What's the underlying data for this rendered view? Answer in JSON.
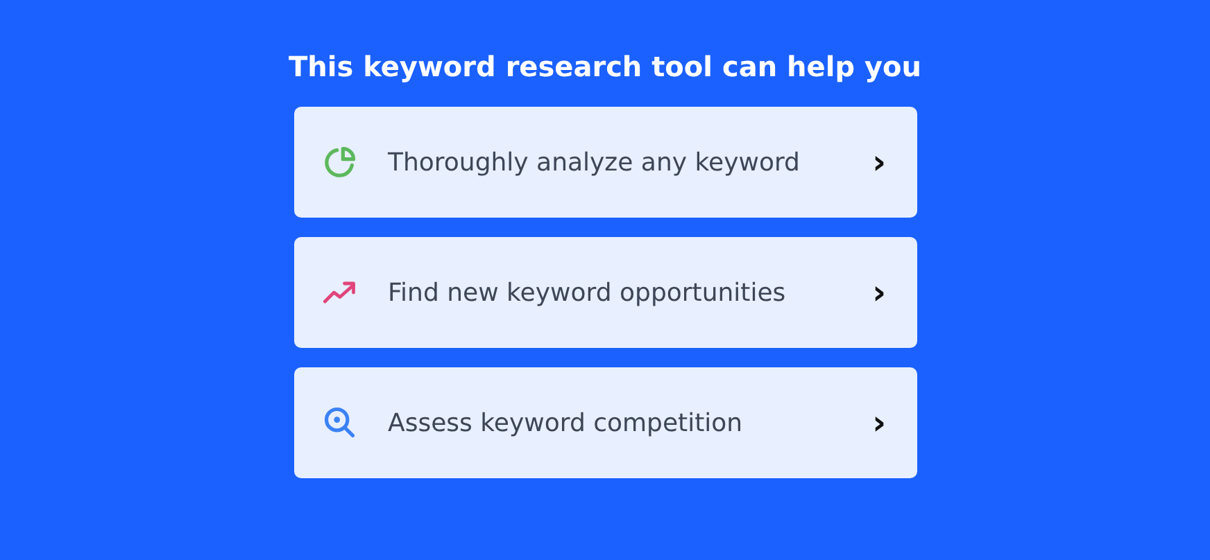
{
  "title": "This keyword research tool can help you",
  "options": [
    {
      "kind": "pie",
      "label": "Thoroughly analyze any keyword",
      "arrow": "›"
    },
    {
      "kind": "trend",
      "label": "Find new keyword opportunities",
      "arrow": "›"
    },
    {
      "kind": "search",
      "label": "Assess keyword competition",
      "arrow": "›"
    }
  ]
}
